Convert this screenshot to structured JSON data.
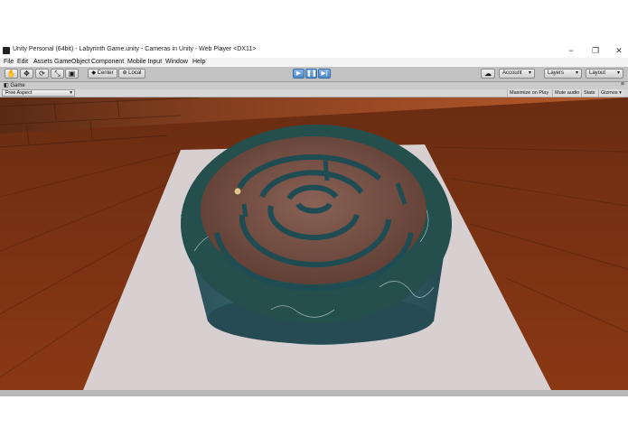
{
  "window": {
    "title": "Unity Personal (64bit) - Labyrinth Game.unity - Cameras in Unity - Web Player <DX11>",
    "minimize_glyph": "−",
    "maximize_glyph": "❐",
    "close_glyph": "✕"
  },
  "menu": [
    "File",
    "Edit",
    "Assets",
    "GameObject",
    "Component",
    "Mobile Input",
    "Window",
    "Help"
  ],
  "toolbar": {
    "tools": [
      {
        "name": "hand-tool",
        "glyph": "✋"
      },
      {
        "name": "move-tool",
        "glyph": "✥"
      },
      {
        "name": "rotate-tool",
        "glyph": "⟳"
      },
      {
        "name": "scale-tool",
        "glyph": "⤡"
      },
      {
        "name": "rect-tool",
        "glyph": "▣"
      }
    ],
    "pivot_label": "Center",
    "space_label": "Local",
    "play_glyph": "▶",
    "pause_glyph": "❚❚",
    "step_glyph": "▶|",
    "cloud_glyph": "☁",
    "account_label": "Account",
    "layers_label": "Layers",
    "layout_label": "Layout"
  },
  "game_view": {
    "tab_label": "Game",
    "tab_menu_glyph": "≡",
    "aspect_label": "Free Aspect",
    "options": [
      "Maximize on Play",
      "Mute audio",
      "Stats",
      "Gizmos"
    ]
  },
  "colors": {
    "wall": "#8a4422",
    "floor": "#7a3414",
    "carpet": "#d9d2d2",
    "marble": "#1f4e4c",
    "maze_wood": "#7a5347",
    "ball": "#e0c58c"
  }
}
